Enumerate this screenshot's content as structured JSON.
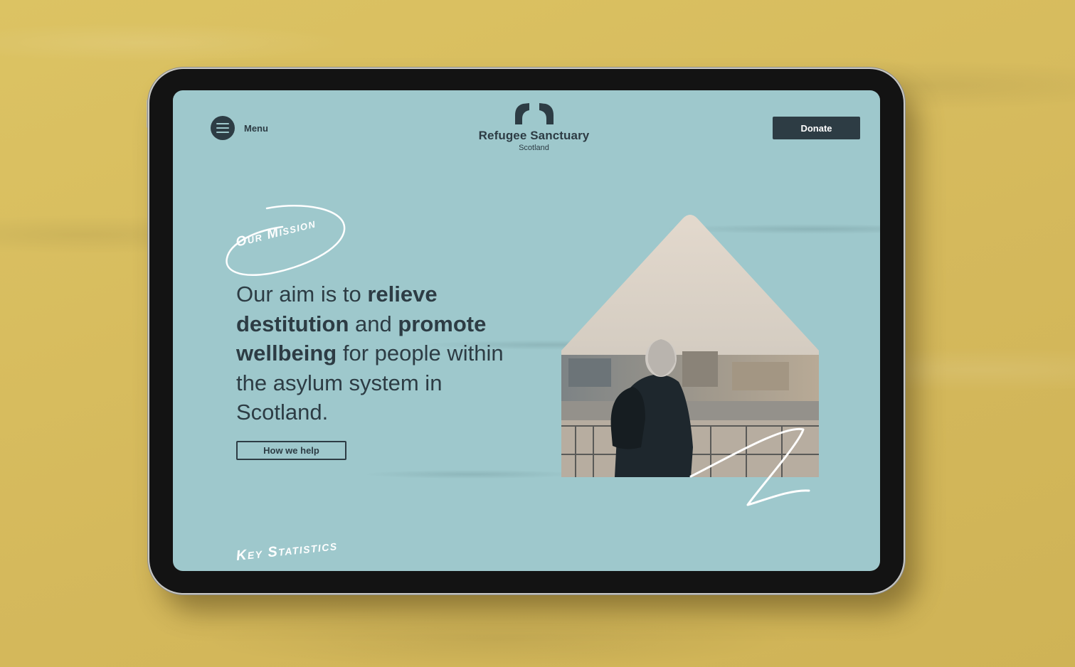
{
  "header": {
    "menu_label": "Menu",
    "logo_name": "Refugee Sanctuary",
    "logo_sub": "Scotland",
    "donate_label": "Donate"
  },
  "hero": {
    "badge": "Our Mission",
    "statement": {
      "p1": "Our aim is to ",
      "b1": "relieve destitution",
      "p2": " and ",
      "b2": "promote wellbeing",
      "p3": " for people within the asylum system in Scotland."
    },
    "cta_label": "How we help"
  },
  "section_heading": "Key Statistics",
  "colors": {
    "background": "#d7bd5f",
    "screen": "#9ec8cc",
    "ink": "#2d3c44",
    "accent_text": "#ffffff"
  },
  "icons": {
    "menu": "hamburger-icon",
    "logo": "roof-logo-icon"
  }
}
